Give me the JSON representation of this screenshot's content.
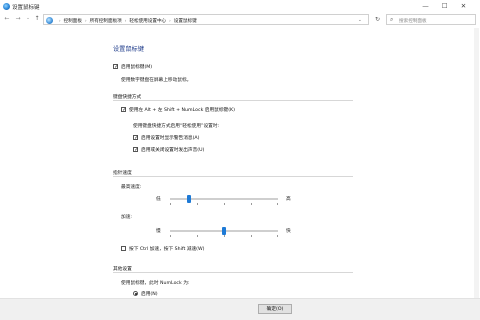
{
  "window": {
    "title": "设置鼠标键",
    "min": "—",
    "max": "☐",
    "close": "✕"
  },
  "nav": {
    "back": "←",
    "forward": "→",
    "recent": "⌄",
    "up": "↑",
    "refresh": "↻",
    "dropdown": "⌄",
    "breadcrumbs": [
      "控制面板",
      "所有控制面板项",
      "轻松使用设置中心",
      "设置鼠标键"
    ],
    "separator": "›",
    "search_placeholder": "搜索控制面板",
    "search_icon": "⌕"
  },
  "main": {
    "heading": "设置鼠标键",
    "enable_mousekeys": {
      "label": "启用鼠标键(M)",
      "checked": true
    },
    "enable_desc": "使用数字键盘在屏幕上移动鼠标。",
    "shortcut_group": {
      "title": "键盘快捷方式",
      "use_shortcut": {
        "label": "使用左 Alt + 左 Shift + NumLock 启用鼠标键(K)",
        "checked": true
      },
      "sub_desc": "使用键盘快捷方式启用“轻松使用”设置时:",
      "warn_msg": {
        "label": "启用设置时显示警告消息(A)",
        "checked": true
      },
      "sound": {
        "label": "启用或关闭设置时发出声音(U)",
        "checked": true
      }
    },
    "pointer_speed": {
      "title": "指针速度",
      "top_speed": {
        "label": "最高速度:",
        "min": "低",
        "max": "高",
        "value": 0.18
      },
      "acceleration": {
        "label": "加速:",
        "min": "慢",
        "max": "快",
        "value": 0.5
      },
      "ctrl_shift": {
        "label": "按下 Ctrl 加速，按下 Shift 减速(W)",
        "checked": false
      }
    },
    "other": {
      "title": "其他设置",
      "use_when": "使用鼠标键，此时 NumLock 为:",
      "on_option": {
        "label": "启用(N)",
        "selected": true
      }
    }
  },
  "footer": {
    "apply": "确定(O)"
  }
}
